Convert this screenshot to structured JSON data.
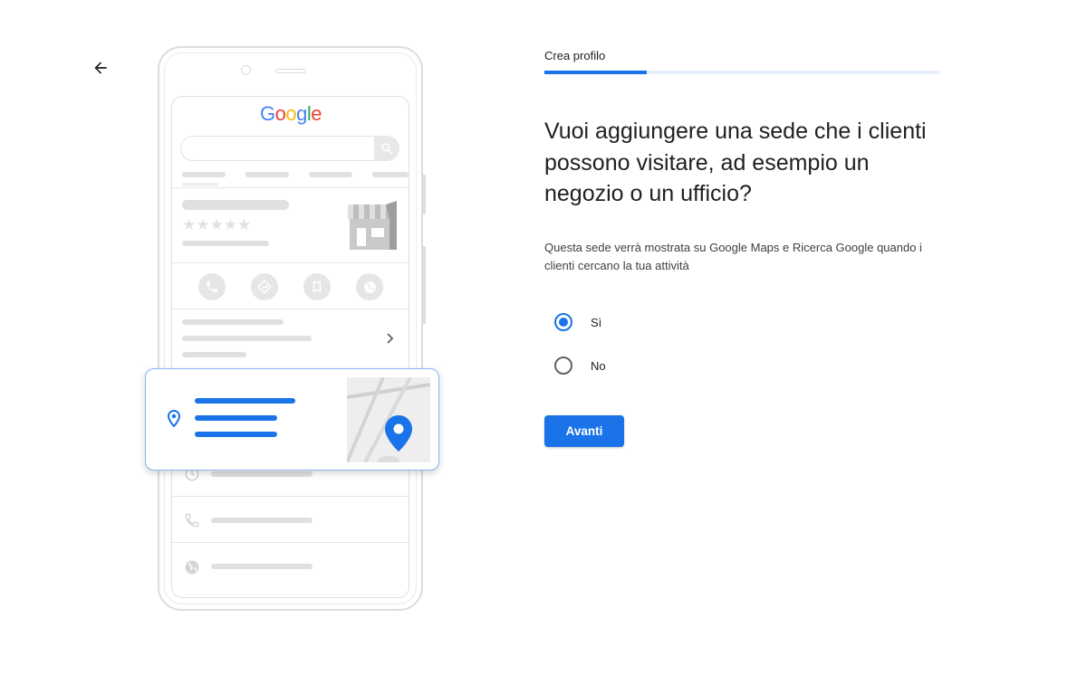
{
  "header": {
    "back_icon": "arrow-back-icon"
  },
  "illustration": {
    "logo": {
      "letters": [
        "G",
        "o",
        "o",
        "g",
        "l",
        "e"
      ],
      "colors": [
        "#4285f4",
        "#ea4335",
        "#fbbc05",
        "#4285f4",
        "#34a853",
        "#ea4335"
      ]
    },
    "rating_stars": "★★★★★",
    "action_icons": [
      "phone-icon",
      "directions-icon",
      "bookmark-icon",
      "globe-icon"
    ],
    "accent_color": "#1a73e8"
  },
  "stepper": {
    "label": "Crea profilo",
    "progress": 0.26
  },
  "main": {
    "headline": "Vuoi aggiungere una sede che i clienti possono visitare, ad esempio un negozio o un ufficio?",
    "description": "Questa sede verrà mostrata su Google Maps e Ricerca Google quando i clienti cercano la tua attività",
    "options": [
      {
        "label": "Sì",
        "selected": true
      },
      {
        "label": "No",
        "selected": false
      }
    ],
    "next_label": "Avanti"
  }
}
